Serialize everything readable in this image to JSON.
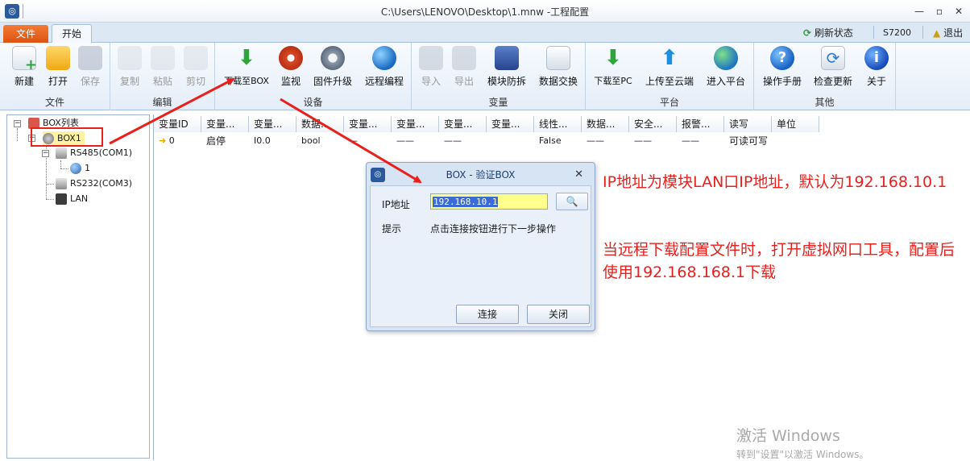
{
  "window": {
    "title": "C:\\Users\\LENOVO\\Desktop\\1.mnw  -工程配置",
    "minimize": "—",
    "restore": "▫",
    "close": "✕"
  },
  "tabs": {
    "file": "文件",
    "start": "开始",
    "refresh": "刷新状态",
    "model": "S7200",
    "logout": "退出"
  },
  "ribbon": {
    "file_group": "文件",
    "edit_group": "编辑",
    "device_group": "设备",
    "variable_group": "变量",
    "platform_group": "平台",
    "other_group": "其他",
    "new": "新建",
    "open": "打开",
    "save": "保存",
    "copy": "复制",
    "paste": "粘贴",
    "cut": "剪切",
    "download_box": "下载至BOX",
    "monitor": "监视",
    "firmware": "固件升级",
    "remote": "远程编程",
    "import": "导入",
    "export": "导出",
    "anti_tamper": "模块防拆",
    "data_exchange": "数据交换",
    "download_pc": "下载至PC",
    "upload_cloud": "上传至云端",
    "enter_platform": "进入平台",
    "manual": "操作手册",
    "check_update": "检查更新",
    "about": "关于"
  },
  "tree": {
    "root": "BOX列表",
    "box1": "BOX1",
    "rs485": "RS485(COM1)",
    "node1": "1",
    "rs232": "RS232(COM3)",
    "lan": "LAN"
  },
  "grid": {
    "headers": [
      "变量ID",
      "变量...",
      "变量...",
      "数据...",
      "变量...",
      "变量...",
      "变量...",
      "变量...",
      "线性...",
      "数据...",
      "安全...",
      "报警...",
      "读写",
      "单位"
    ],
    "row": [
      "0",
      "启停",
      "I0.0",
      "bool",
      "—",
      "——",
      "——",
      "",
      "False",
      "——",
      "——",
      "——",
      "可读可写",
      ""
    ]
  },
  "dialog": {
    "title": "BOX - 验证BOX",
    "close": "✕",
    "ip_label": "IP地址",
    "ip_value": "192.168.10.1",
    "hint_label": "提示",
    "hint_text": "点击连接按钮进行下一步操作",
    "connect": "连接",
    "cancel": "关闭"
  },
  "annotations": {
    "line1": "IP地址为模块LAN口IP地址，默认为192.168.10.1",
    "line2": "当远程下载配置文件时，打开虚拟网口工具，配置后使用192.168.168.1下载"
  },
  "watermark": {
    "line1": "激活 Windows",
    "line2": "转到\"设置\"以激活 Windows。"
  }
}
